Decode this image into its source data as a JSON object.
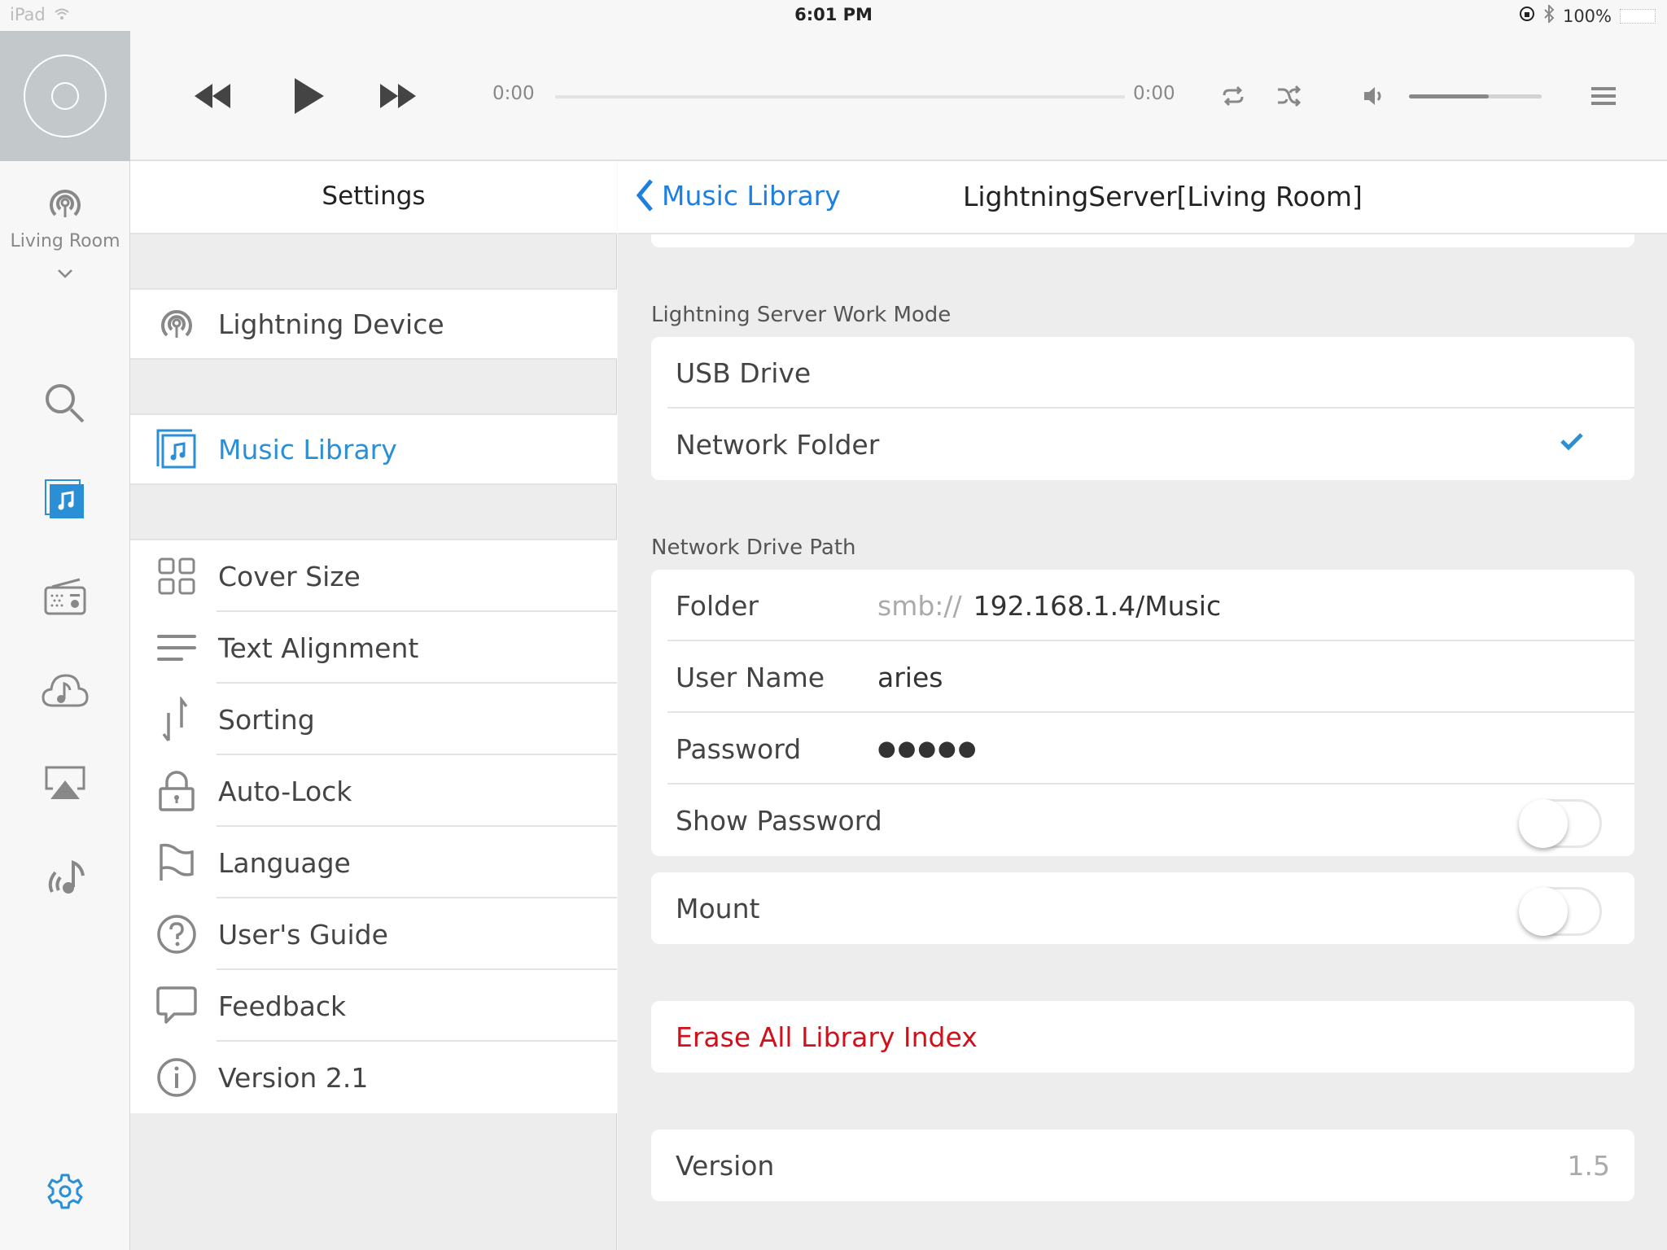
{
  "status_bar": {
    "device": "iPad",
    "time": "6:01 PM",
    "battery": "100%"
  },
  "player": {
    "elapsed": "0:00",
    "duration": "0:00",
    "progress_fraction": 0,
    "volume_fraction": 0.6
  },
  "nav": {
    "room": "Living Room",
    "items": [
      "search",
      "music-library",
      "radio",
      "cloud-music",
      "airplay",
      "stream-music",
      "settings"
    ],
    "active": "music-library",
    "accent_color": "#2b8fd6"
  },
  "settings": {
    "title": "Settings",
    "device_item": "Lightning Device",
    "library_item": "Music Library",
    "items": [
      {
        "label": "Cover Size",
        "icon": "grid-icon"
      },
      {
        "label": "Text Alignment",
        "icon": "align-left-icon"
      },
      {
        "label": "Sorting",
        "icon": "sort-icon"
      },
      {
        "label": "Auto-Lock",
        "icon": "lock-icon"
      },
      {
        "label": "Language",
        "icon": "flag-icon"
      },
      {
        "label": "User's Guide",
        "icon": "help-icon"
      },
      {
        "label": "Feedback",
        "icon": "speech-bubble-icon"
      },
      {
        "label": "Version 2.1",
        "icon": "info-icon"
      }
    ]
  },
  "detail": {
    "back_label": "Music Library",
    "title": "LightningServer[Living Room]",
    "work_mode": {
      "label": "Lightning Server Work Mode",
      "options": [
        "USB Drive",
        "Network Folder"
      ],
      "selected": "Network Folder"
    },
    "network": {
      "label": "Network Drive Path",
      "folder_label": "Folder",
      "folder_prefix": "smb://",
      "folder_value": "192.168.1.4/Music",
      "user_label": "User Name",
      "user_value": "aries",
      "password_label": "Password",
      "password_value": "●●●●●",
      "show_password_label": "Show Password",
      "show_password": false
    },
    "mount_label": "Mount",
    "mount": false,
    "erase_label": "Erase All Library Index",
    "erase_color": "#d0111b",
    "version_label": "Version",
    "version_value": "1.5"
  }
}
